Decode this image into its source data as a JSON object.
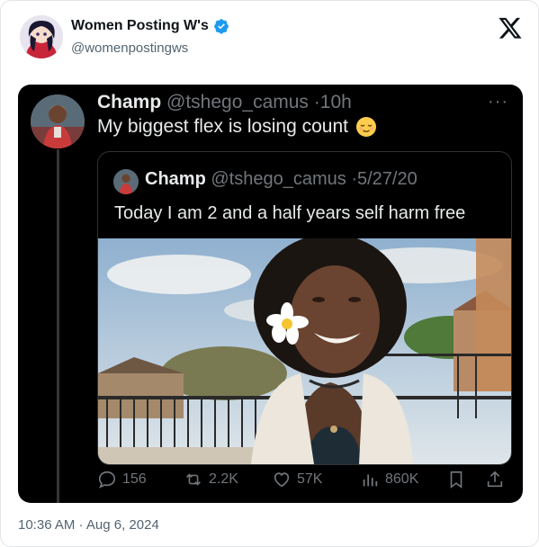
{
  "outer": {
    "display_name": "Women Posting W's",
    "handle": "@womenpostingws",
    "timestamp": "10:36 AM · Aug 6, 2024"
  },
  "post": {
    "display_name": "Champ",
    "handle": "@tshego_camus",
    "time_sep": "·",
    "time": "10h",
    "text": "My biggest flex is losing count",
    "more": "···"
  },
  "quote": {
    "display_name": "Champ",
    "handle": "@tshego_camus",
    "time_sep": "·",
    "date": "5/27/20",
    "text": "Today I am 2 and a half years self harm free"
  },
  "actions": {
    "replies": "156",
    "reposts": "2.2K",
    "likes": "57K",
    "views": "860K"
  },
  "icons": [
    "verified-icon",
    "x-logo-icon",
    "reply-icon",
    "repost-icon",
    "like-icon",
    "views-icon",
    "bookmark-icon",
    "share-icon"
  ],
  "colors": {
    "verified": "#1d9bf0",
    "dark_bg": "#000000",
    "muted": "#71767b"
  }
}
